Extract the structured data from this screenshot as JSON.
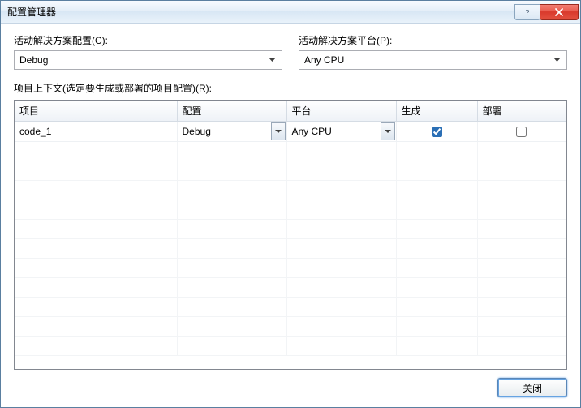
{
  "window": {
    "title": "配置管理器"
  },
  "labels": {
    "activeConfig": "活动解决方案配置(C):",
    "activePlatform": "活动解决方案平台(P):",
    "context": "项目上下文(选定要生成或部署的项目配置)(R):"
  },
  "comboboxes": {
    "activeConfig": "Debug",
    "activePlatform": "Any CPU"
  },
  "grid": {
    "columns": {
      "project": "项目",
      "config": "配置",
      "platform": "平台",
      "build": "生成",
      "deploy": "部署"
    },
    "row0": {
      "project": "code_1",
      "config": "Debug",
      "platform": "Any CPU",
      "build": true,
      "deploy": false
    }
  },
  "buttons": {
    "close": "关闭"
  },
  "icons": {
    "help": "help-icon",
    "close": "close-icon",
    "dropdown": "chevron-down-icon"
  }
}
